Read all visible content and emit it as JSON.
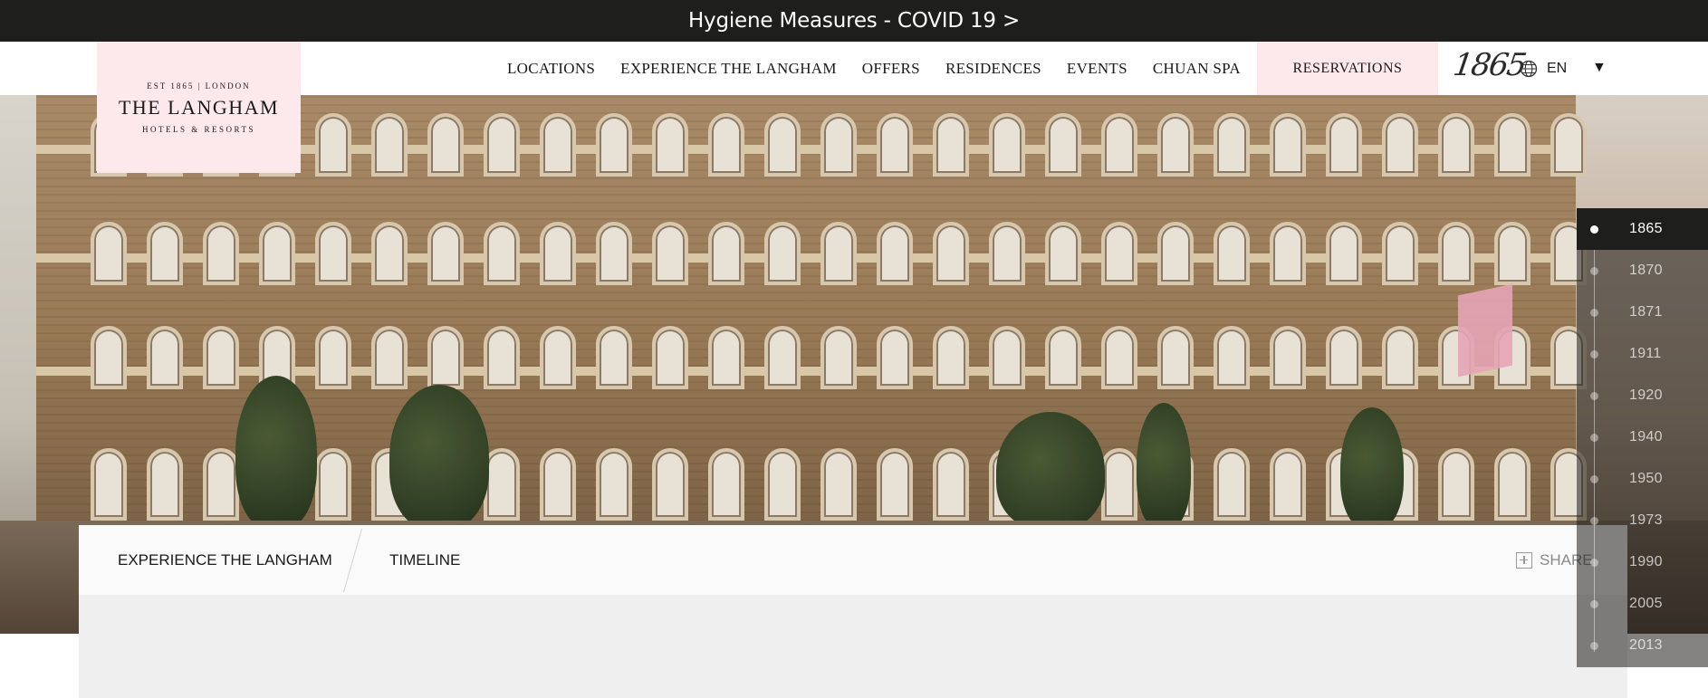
{
  "alert": {
    "text": "Hygiene Measures - COVID 19 >"
  },
  "logo": {
    "est": "EST 1865 | LONDON",
    "name": "THE LANGHAM",
    "sub": "HOTELS & RESORTS"
  },
  "nav": {
    "items": [
      "LOCATIONS",
      "EXPERIENCE THE LANGHAM",
      "OFFERS",
      "RESIDENCES",
      "EVENTS",
      "CHUAN SPA"
    ],
    "reservations": "RESERVATIONS",
    "script_logo": "1865",
    "language": "EN"
  },
  "breadcrumb": {
    "parent": "EXPERIENCE THE LANGHAM",
    "current": "TIMELINE"
  },
  "share": {
    "label": "SHARE"
  },
  "timeline": {
    "years": [
      "1865",
      "1870",
      "1871",
      "1911",
      "1920",
      "1940",
      "1950",
      "1973",
      "1990",
      "2005",
      "2013"
    ],
    "active_index": 0
  },
  "icons": {
    "language": "globe-icon",
    "dropdown": "chevron-down-icon",
    "share": "plus-square-icon"
  },
  "colors": {
    "accent_pink": "#fde8ec",
    "dark_bar": "#1e1e1c"
  }
}
